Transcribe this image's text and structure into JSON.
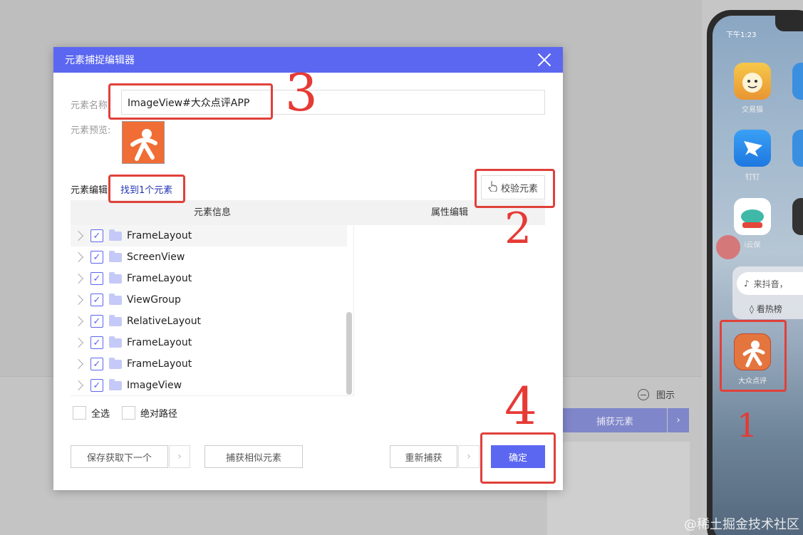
{
  "background": {
    "tushi_label": "图示",
    "capture_btn_label": "捕获元素",
    "capture_arrow": "›"
  },
  "phone": {
    "status_time": "下午1:23",
    "apps": [
      {
        "label": "交易猫"
      },
      {
        "label": "钉钉"
      },
      {
        "label": "i云保"
      },
      {
        "label": "大众点评"
      }
    ],
    "douyin_search": "来抖音，",
    "douyin_hot": "看热榜"
  },
  "watermark": "@稀土掘金技术社区",
  "dialog": {
    "title": "元素捕捉编辑器",
    "name_label": "元素名称:",
    "name_value": "ImageView#大众点评APP",
    "preview_label": "元素预览:",
    "edit_label": "元素编辑:",
    "found_text": "找到1个元素",
    "verify_label": "校验元素",
    "col_info": "元素信息",
    "col_attr": "属性编辑",
    "tree": [
      {
        "label": "FrameLayout",
        "checked": true
      },
      {
        "label": "ScreenView",
        "checked": true
      },
      {
        "label": "FrameLayout",
        "checked": true
      },
      {
        "label": "ViewGroup",
        "checked": true
      },
      {
        "label": "RelativeLayout",
        "checked": true
      },
      {
        "label": "FrameLayout",
        "checked": true
      },
      {
        "label": "FrameLayout",
        "checked": true
      },
      {
        "label": "ImageView",
        "checked": true
      }
    ],
    "select_all": "全选",
    "absolute_path": "绝对路径",
    "save_next": "保存获取下一个",
    "capture_similar": "捕获相似元素",
    "recapture": "重新捕获",
    "ok": "确定",
    "arrow": "›"
  },
  "annotations": {
    "n1": "1",
    "n2": "2",
    "n3": "3",
    "n4": "4"
  },
  "colors": {
    "accent": "#5b67f0",
    "annotation_red": "#e0403a",
    "link": "#2334b5"
  }
}
